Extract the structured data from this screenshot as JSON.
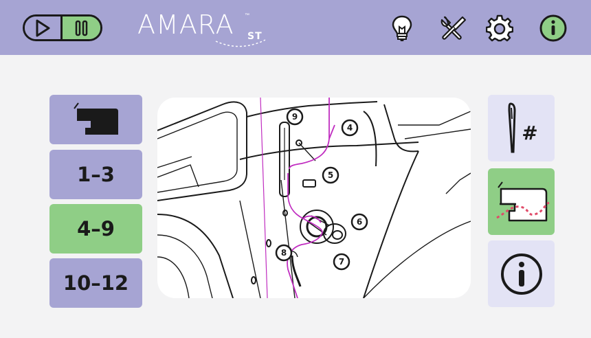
{
  "header": {
    "brand": "AMARA",
    "brand_suffix": "ST",
    "brand_tm": "™",
    "icons": [
      "play-icon",
      "pause-icon",
      "lightbulb-icon",
      "tools-icon",
      "gear-icon",
      "info-icon"
    ],
    "colors": {
      "bar": "#a6a4d3",
      "active": "#8fce86",
      "info_bg": "#8fce86"
    }
  },
  "left_nav": {
    "items": [
      {
        "label": "",
        "icon": "sewing-machine-icon"
      },
      {
        "label": "1–3"
      },
      {
        "label": "4–9",
        "active": true
      },
      {
        "label": "10–12"
      }
    ]
  },
  "diagram": {
    "steps": [
      "9",
      "4",
      "5",
      "6",
      "8",
      "7"
    ],
    "thread_color": "#c02cc0"
  },
  "right_nav": {
    "items": [
      {
        "icon": "needle-number-icon",
        "label": "#"
      },
      {
        "icon": "sewing-machine-threading-icon",
        "active": true
      },
      {
        "icon": "info-circle-icon",
        "label": "i"
      }
    ]
  }
}
